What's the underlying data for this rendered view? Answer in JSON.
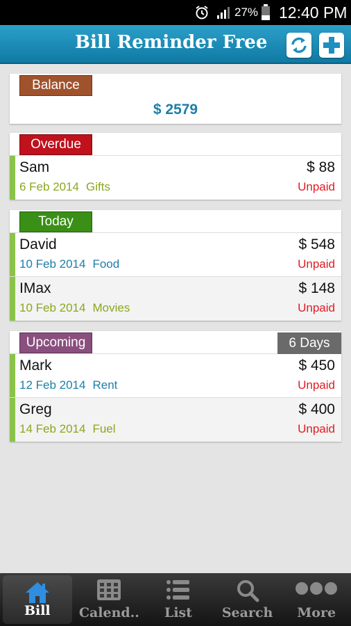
{
  "status_bar": {
    "battery_pct": "27%",
    "time": "12:40 PM",
    "icons": [
      "alarm-icon",
      "signal-icon",
      "battery-icon"
    ]
  },
  "header": {
    "title": "Bill Reminder Free",
    "buttons": [
      "sync-icon",
      "add-icon"
    ]
  },
  "balance": {
    "label": "Balance",
    "amount": "$ 2579"
  },
  "sections": {
    "overdue": {
      "label": "Overdue",
      "bills": [
        {
          "name": "Sam",
          "amount": "$ 88",
          "date": "6 Feb 2014",
          "category": "Gifts",
          "status": "Unpaid"
        }
      ]
    },
    "today": {
      "label": "Today",
      "bills": [
        {
          "name": "David",
          "amount": "$ 548",
          "date": "10 Feb 2014",
          "category": "Food",
          "status": "Unpaid"
        },
        {
          "name": "IMax",
          "amount": "$ 148",
          "date": "10 Feb 2014",
          "category": "Movies",
          "status": "Unpaid"
        }
      ]
    },
    "upcoming": {
      "label": "Upcoming",
      "days": "6 Days",
      "bills": [
        {
          "name": "Mark",
          "amount": "$ 450",
          "date": "12 Feb 2014",
          "category": "Rent",
          "status": "Unpaid"
        },
        {
          "name": "Greg",
          "amount": "$ 400",
          "date": "14 Feb 2014",
          "category": "Fuel",
          "status": "Unpaid"
        }
      ]
    }
  },
  "colors": {
    "header": "#1b8db8",
    "balance_tag": "#a0522d",
    "overdue_tag": "#c0111c",
    "today_tag": "#3a8f16",
    "upcoming_tag": "#8a4f7e",
    "unpaid": "#e11b22",
    "meta_green": "#8aa71f",
    "meta_blue": "#1d7ea8"
  },
  "bottom_nav": {
    "active": "Bill",
    "items": [
      {
        "label": "Bill",
        "icon": "home-icon"
      },
      {
        "label": "Calend..",
        "icon": "calendar-icon"
      },
      {
        "label": "List",
        "icon": "list-icon"
      },
      {
        "label": "Search",
        "icon": "search-icon"
      },
      {
        "label": "More",
        "icon": "more-icon"
      }
    ]
  }
}
